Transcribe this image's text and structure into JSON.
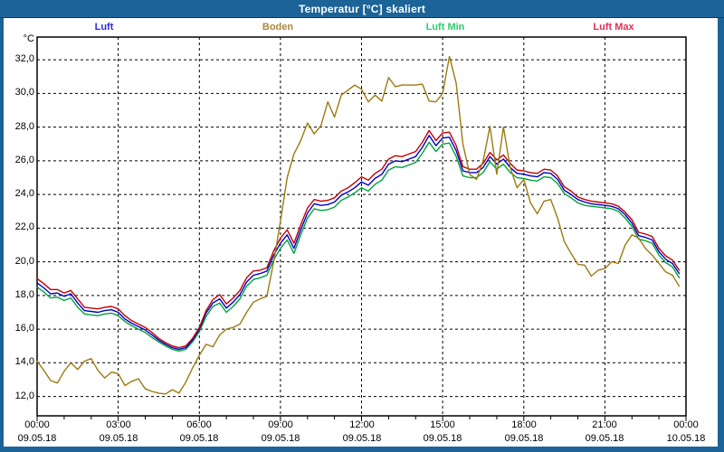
{
  "window": {
    "title": "Temperatur [°C] skaliert",
    "titlebar_color": "#1C6398",
    "frame_color": "#1C6398",
    "titlebar_text_color": "#FFFFFF"
  },
  "legend": {
    "items": [
      {
        "label": "Luft",
        "color": "#2A2AE6"
      },
      {
        "label": "Boden",
        "color": "#A8873C"
      },
      {
        "label": "Luft Min",
        "color": "#2FCC6E"
      },
      {
        "label": "Luft Max",
        "color": "#E03254"
      }
    ]
  },
  "chart_data": {
    "type": "line",
    "title": "Temperatur [°C] skaliert",
    "y_unit_label": "°C",
    "ylim": [
      10.85,
      33.35
    ],
    "grid": "dashed",
    "legend_position": "top",
    "x_start_hour": 0,
    "x_step_hours": 0.25,
    "y_ticks": [
      {
        "value": 12,
        "label": "12,0"
      },
      {
        "value": 14,
        "label": "14,0"
      },
      {
        "value": 16,
        "label": "16,0"
      },
      {
        "value": 18,
        "label": "18,0"
      },
      {
        "value": 20,
        "label": "20,0"
      },
      {
        "value": 22,
        "label": "22,0"
      },
      {
        "value": 24,
        "label": "24,0"
      },
      {
        "value": 26,
        "label": "26,0"
      },
      {
        "value": 28,
        "label": "28,0"
      },
      {
        "value": 30,
        "label": "30,0"
      },
      {
        "value": 32,
        "label": "32,0"
      }
    ],
    "x_ticks": [
      {
        "hour": 0,
        "time": "00:00",
        "date": "09.05.18"
      },
      {
        "hour": 3,
        "time": "03:00",
        "date": "09.05.18"
      },
      {
        "hour": 6,
        "time": "06:00",
        "date": "09.05.18"
      },
      {
        "hour": 9,
        "time": "09:00",
        "date": "09.05.18"
      },
      {
        "hour": 12,
        "time": "12:00",
        "date": "09.05.18"
      },
      {
        "hour": 15,
        "time": "15:00",
        "date": "09.05.18"
      },
      {
        "hour": 18,
        "time": "18:00",
        "date": "09.05.18"
      },
      {
        "hour": 21,
        "time": "21:00",
        "date": "09.05.18"
      },
      {
        "hour": 24,
        "time": "00:00",
        "date": "10.05.18"
      }
    ],
    "series": [
      {
        "name": "Luft Min",
        "color": "#00A23C",
        "values": [
          18.5,
          18.2,
          17.85,
          17.9,
          17.7,
          17.85,
          17.3,
          16.9,
          16.85,
          16.8,
          16.9,
          16.95,
          16.8,
          16.45,
          16.2,
          16.0,
          15.8,
          15.5,
          15.25,
          15.0,
          14.8,
          14.7,
          14.8,
          15.25,
          15.85,
          16.75,
          17.35,
          17.55,
          17.0,
          17.35,
          17.8,
          18.55,
          18.95,
          19.05,
          19.2,
          20.1,
          20.8,
          21.3,
          20.5,
          21.6,
          22.6,
          23.15,
          23.05,
          23.1,
          23.25,
          23.65,
          23.85,
          24.1,
          24.4,
          24.2,
          24.6,
          24.85,
          25.45,
          25.65,
          25.6,
          25.75,
          25.9,
          26.45,
          27.1,
          26.55,
          27.0,
          27.05,
          26.25,
          25.1,
          25.0,
          25.0,
          25.3,
          25.95,
          25.5,
          25.8,
          25.3,
          25.0,
          24.95,
          24.85,
          24.8,
          25.05,
          25.0,
          24.65,
          24.05,
          23.8,
          23.5,
          23.35,
          23.3,
          23.25,
          23.2,
          23.15,
          23.0,
          22.6,
          22.1,
          21.35,
          21.25,
          21.1,
          20.4,
          19.95,
          19.7,
          19.05
        ]
      },
      {
        "name": "Luft",
        "color": "#0000CC",
        "values": [
          18.75,
          18.45,
          18.1,
          18.15,
          17.95,
          18.1,
          17.55,
          17.1,
          17.05,
          17.0,
          17.1,
          17.15,
          17.0,
          16.6,
          16.35,
          16.15,
          15.95,
          15.65,
          15.35,
          15.1,
          14.9,
          14.8,
          14.9,
          15.35,
          16.0,
          16.95,
          17.55,
          17.8,
          17.25,
          17.6,
          18.05,
          18.8,
          19.2,
          19.3,
          19.45,
          20.4,
          21.1,
          21.6,
          20.8,
          21.9,
          22.9,
          23.45,
          23.35,
          23.4,
          23.55,
          23.95,
          24.15,
          24.4,
          24.75,
          24.55,
          24.95,
          25.2,
          25.8,
          26.0,
          25.95,
          26.1,
          26.25,
          26.8,
          27.5,
          26.9,
          27.35,
          27.4,
          26.6,
          25.4,
          25.3,
          25.3,
          25.6,
          26.25,
          25.8,
          26.1,
          25.6,
          25.25,
          25.2,
          25.1,
          25.05,
          25.3,
          25.25,
          24.9,
          24.25,
          24.0,
          23.7,
          23.55,
          23.45,
          23.4,
          23.35,
          23.3,
          23.15,
          22.8,
          22.3,
          21.55,
          21.45,
          21.3,
          20.6,
          20.15,
          19.9,
          19.3
        ]
      },
      {
        "name": "Luft Max",
        "color": "#C40000",
        "values": [
          19.0,
          18.7,
          18.35,
          18.35,
          18.15,
          18.3,
          17.8,
          17.3,
          17.25,
          17.2,
          17.3,
          17.35,
          17.2,
          16.8,
          16.5,
          16.3,
          16.1,
          15.8,
          15.45,
          15.2,
          15.0,
          14.9,
          15.0,
          15.45,
          16.1,
          17.1,
          17.75,
          18.05,
          17.5,
          17.85,
          18.3,
          19.05,
          19.45,
          19.5,
          19.65,
          20.65,
          21.4,
          21.9,
          21.1,
          22.2,
          23.2,
          23.7,
          23.6,
          23.65,
          23.8,
          24.2,
          24.4,
          24.7,
          25.05,
          24.85,
          25.25,
          25.5,
          26.1,
          26.3,
          26.25,
          26.4,
          26.55,
          27.1,
          27.8,
          27.2,
          27.65,
          27.7,
          26.9,
          25.65,
          25.5,
          25.5,
          25.85,
          26.5,
          26.05,
          26.35,
          25.85,
          25.45,
          25.4,
          25.3,
          25.25,
          25.5,
          25.45,
          25.1,
          24.45,
          24.2,
          23.85,
          23.7,
          23.6,
          23.55,
          23.5,
          23.45,
          23.3,
          22.95,
          22.5,
          21.75,
          21.65,
          21.5,
          20.8,
          20.35,
          20.1,
          19.5
        ]
      },
      {
        "name": "Boden",
        "color": "#9C7B10",
        "values": [
          14.1,
          13.55,
          12.95,
          12.8,
          13.5,
          14.0,
          13.6,
          14.1,
          14.25,
          13.55,
          13.1,
          13.45,
          13.35,
          12.65,
          12.9,
          13.05,
          12.45,
          12.3,
          12.2,
          12.15,
          12.4,
          12.2,
          12.85,
          13.7,
          14.45,
          15.1,
          14.95,
          15.65,
          16.0,
          16.1,
          16.3,
          17.0,
          17.6,
          17.8,
          17.95,
          20.0,
          22.4,
          25.0,
          26.4,
          27.2,
          28.25,
          27.6,
          28.1,
          29.5,
          28.6,
          29.9,
          30.2,
          30.5,
          30.25,
          29.5,
          29.9,
          29.55,
          30.95,
          30.4,
          30.5,
          30.5,
          30.5,
          30.55,
          29.55,
          29.5,
          30.0,
          32.2,
          30.6,
          27.0,
          25.2,
          24.9,
          26.0,
          28.05,
          25.2,
          28.0,
          25.6,
          24.4,
          24.9,
          23.5,
          22.85,
          23.6,
          23.7,
          22.6,
          21.2,
          20.5,
          19.85,
          19.8,
          19.15,
          19.5,
          19.6,
          20.0,
          19.9,
          21.0,
          21.6,
          21.4,
          20.8,
          20.4,
          19.9,
          19.4,
          19.2,
          18.55
        ]
      }
    ]
  }
}
